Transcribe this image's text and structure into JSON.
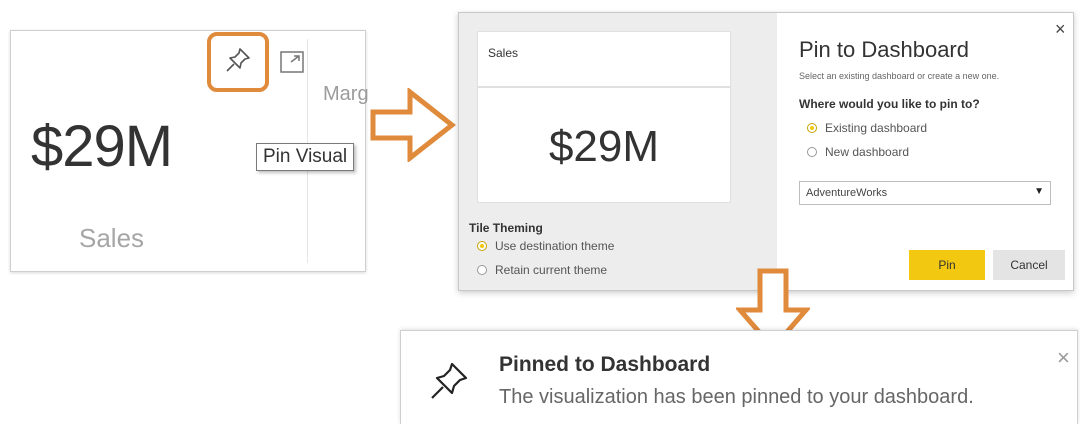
{
  "kpi_card": {
    "value": "$29M",
    "label": "Sales",
    "partial_text": "Marg",
    "tooltip": "Pin Visual",
    "icons": [
      "pin-icon",
      "focus-mode-icon"
    ]
  },
  "dialog": {
    "preview": {
      "tile_title": "Sales",
      "tile_value": "$29M"
    },
    "theming": {
      "title": "Tile Theming",
      "options": [
        "Use destination theme",
        "Retain current theme"
      ],
      "selected": "Use destination theme"
    },
    "title": "Pin to Dashboard",
    "subtitle": "Select an existing dashboard or create a new one.",
    "question": "Where would you like to pin to?",
    "destination_options": [
      "Existing dashboard",
      "New dashboard"
    ],
    "selected_destination": "Existing dashboard",
    "dashboard_select": "AdventureWorks",
    "pin_label": "Pin",
    "cancel_label": "Cancel",
    "close_glyph": "×"
  },
  "notification": {
    "title": "Pinned to Dashboard",
    "message": "The visualization has been pinned to your dashboard.",
    "close_glyph": "×"
  },
  "colors": {
    "accent_orange": "#e08a3c",
    "pin_button": "#f2c811",
    "cancel_button": "#e4e4e4",
    "dialog_left_bg": "#ededed"
  }
}
